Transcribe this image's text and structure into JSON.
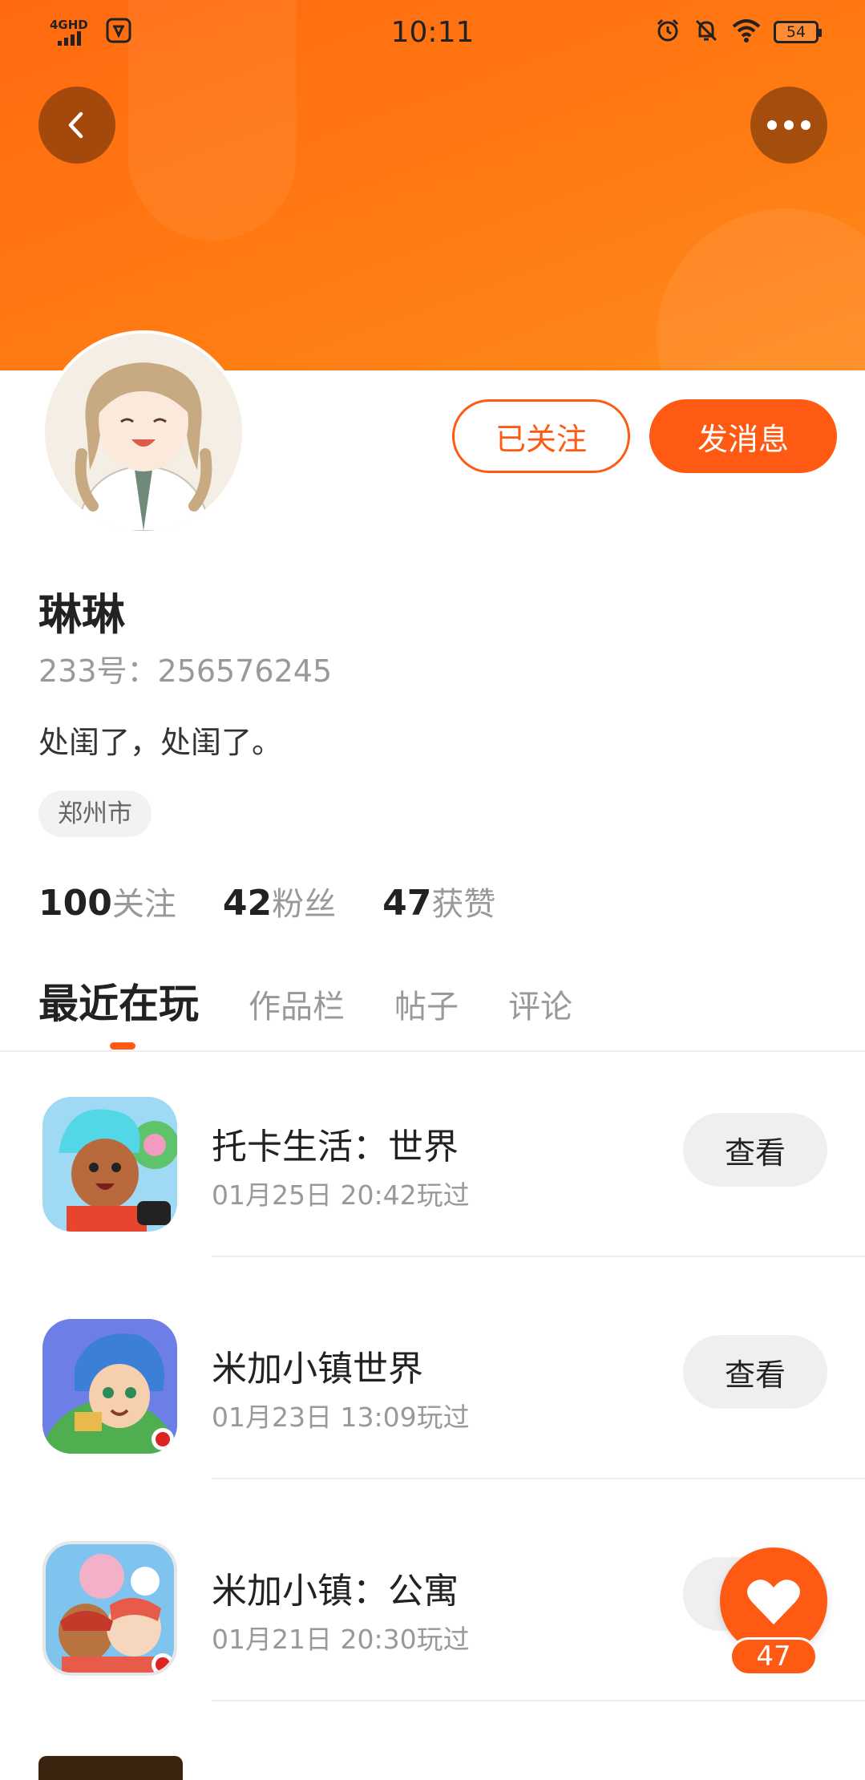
{
  "status_bar": {
    "network": "4GHD",
    "time": "10:11",
    "battery": "54"
  },
  "profile": {
    "name": "琳琳",
    "id_text": "233号：256576245",
    "bio": "处闺了，处闺了。",
    "location": "郑州市",
    "follow_button": "已关注",
    "message_button": "发消息"
  },
  "stats": [
    {
      "number": "100",
      "label": "关注"
    },
    {
      "number": "42",
      "label": "粉丝"
    },
    {
      "number": "47",
      "label": "获赞"
    }
  ],
  "tabs": [
    "最近在玩",
    "作品栏",
    "帖子",
    "评论"
  ],
  "games": [
    {
      "name": "托卡生活：世界",
      "time": "01月25日 20:42玩过",
      "button": "查看"
    },
    {
      "name": "米加小镇世界",
      "time": "01月23日 13:09玩过",
      "button": "查看"
    },
    {
      "name": "米加小镇：公寓",
      "time": "01月21日 20:30玩过",
      "button": "查看"
    }
  ],
  "like_count": "47",
  "colors": {
    "accent": "#ff5a14",
    "header_top": "#ff6a10",
    "header_bottom": "#ff8a1c"
  },
  "icons": {
    "back": "chevron-left-icon",
    "more": "more-dots-icon",
    "like": "heart-icon"
  }
}
